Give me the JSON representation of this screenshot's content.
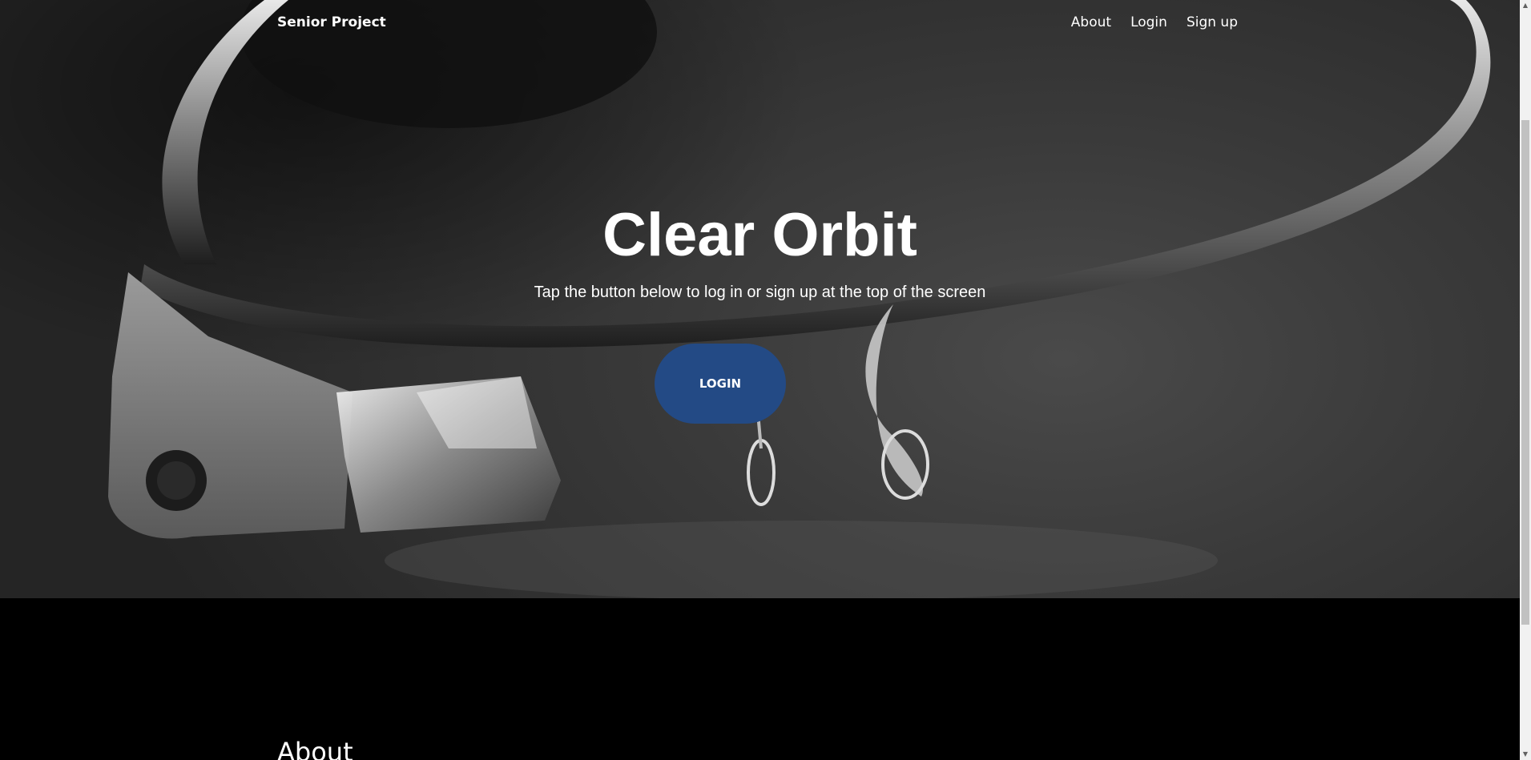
{
  "navbar": {
    "brand": "Senior Project",
    "links": [
      "About",
      "Login",
      "Sign up"
    ]
  },
  "hero": {
    "title": "Clear Orbit",
    "subtitle": "Tap the button below to log in or sign up at the top of the screen",
    "button_label": "LOGIN",
    "button_color": "#234a85"
  },
  "about": {
    "heading": "About"
  },
  "colors": {
    "section_background": "#000000",
    "text": "#ffffff"
  }
}
